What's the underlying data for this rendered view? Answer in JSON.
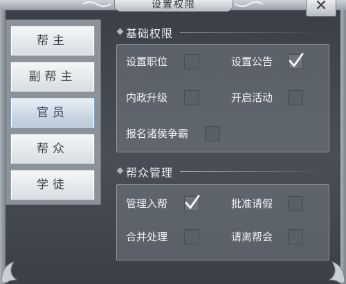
{
  "window": {
    "title": "设置权限",
    "close_glyph": "✕"
  },
  "tabs": [
    {
      "label": "帮主",
      "active": false
    },
    {
      "label": "副帮主",
      "active": false
    },
    {
      "label": "官员",
      "active": true
    },
    {
      "label": "帮众",
      "active": false
    },
    {
      "label": "学徒",
      "active": false
    }
  ],
  "sections": [
    {
      "title": "基础权限",
      "items": [
        {
          "label": "设置职位",
          "checked": false
        },
        {
          "label": "设置公告",
          "checked": true
        },
        {
          "label": "内政升级",
          "checked": false
        },
        {
          "label": "开启活动",
          "checked": false
        },
        {
          "label": "报名诸侯争霸",
          "checked": false
        }
      ]
    },
    {
      "title": "帮众管理",
      "items": [
        {
          "label": "管理入帮",
          "checked": true
        },
        {
          "label": "批准请假",
          "checked": false
        },
        {
          "label": "合并处理",
          "checked": false
        },
        {
          "label": "请离帮会",
          "checked": false
        }
      ]
    }
  ],
  "colors": {
    "accent_tab": "#b8c9d8",
    "checkbox": "#596068",
    "checkmark": "#f2f4f6"
  }
}
